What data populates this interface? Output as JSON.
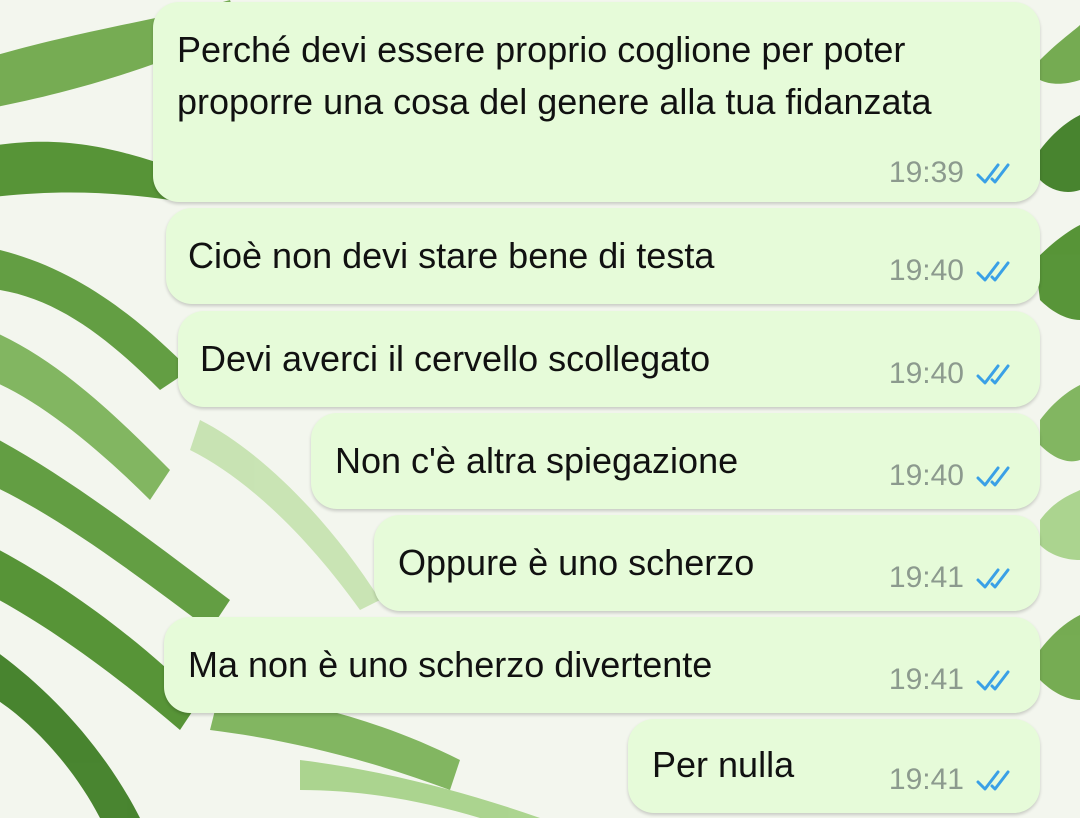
{
  "theme": {
    "bubble_color": "#e6fbd9",
    "tick_color": "#3aa0e6",
    "time_color": "#8c9a8e",
    "wallpaper_leaf_colors": [
      "#4f8f2e",
      "#7cb35a",
      "#a8d38a",
      "#c6e3b0"
    ]
  },
  "messages": [
    {
      "text": "Perché devi essere proprio coglione per poter proporre una cosa del genere alla tua fidanzata",
      "time": "19:39",
      "status": "read-double-check-icon"
    },
    {
      "text": "Cioè non devi stare bene di testa",
      "time": "19:40",
      "status": "read-double-check-icon"
    },
    {
      "text": "Devi averci il cervello scollegato",
      "time": "19:40",
      "status": "read-double-check-icon"
    },
    {
      "text": "Non c'è altra spiegazione",
      "time": "19:40",
      "status": "read-double-check-icon"
    },
    {
      "text": "Oppure è uno scherzo",
      "time": "19:41",
      "status": "read-double-check-icon"
    },
    {
      "text": "Ma non è uno scherzo divertente",
      "time": "19:41",
      "status": "read-double-check-icon"
    },
    {
      "text": "Per nulla",
      "time": "19:41",
      "status": "read-double-check-icon"
    }
  ]
}
